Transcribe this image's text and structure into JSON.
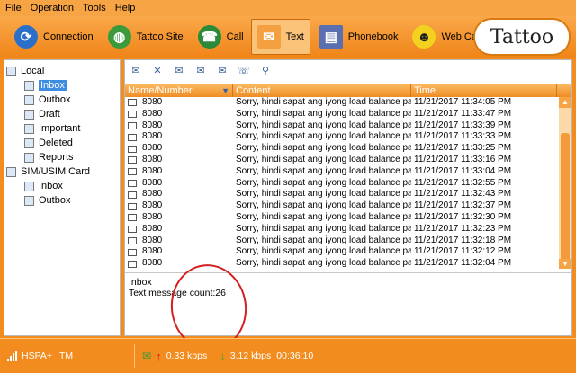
{
  "menu": [
    "File",
    "Operation",
    "Tools",
    "Help"
  ],
  "toolbar": {
    "connection": "Connection",
    "tattoo_site": "Tattoo Site",
    "call": "Call",
    "text": "Text",
    "phonebook": "Phonebook",
    "web_calls": "Web Calls",
    "logo": "Tattoo"
  },
  "tree": {
    "local": "Local",
    "inbox": "Inbox",
    "outbox": "Outbox",
    "draft": "Draft",
    "important": "Important",
    "deleted": "Deleted",
    "reports": "Reports",
    "sim": "SIM/USIM Card",
    "sim_inbox": "Inbox",
    "sim_outbox": "Outbox"
  },
  "columns": {
    "name": "Name/Number",
    "content": "Content",
    "time": "Time"
  },
  "messages": [
    {
      "num": "8080",
      "content": "Sorry, hindi sapat ang iyong load balance para ma...",
      "time": "11/21/2017 11:34:05 PM"
    },
    {
      "num": "8080",
      "content": "Sorry, hindi sapat ang iyong load balance para ma...",
      "time": "11/21/2017 11:33:47 PM"
    },
    {
      "num": "8080",
      "content": "Sorry, hindi sapat ang iyong load balance para ma...",
      "time": "11/21/2017 11:33:39 PM"
    },
    {
      "num": "8080",
      "content": "Sorry, hindi sapat ang iyong load balance para ma...",
      "time": "11/21/2017 11:33:33 PM"
    },
    {
      "num": "8080",
      "content": "Sorry, hindi sapat ang iyong load balance para ma...",
      "time": "11/21/2017 11:33:25 PM"
    },
    {
      "num": "8080",
      "content": "Sorry, hindi sapat ang iyong load balance para ma...",
      "time": "11/21/2017 11:33:16 PM"
    },
    {
      "num": "8080",
      "content": "Sorry, hindi sapat ang iyong load balance para ma...",
      "time": "11/21/2017 11:33:04 PM"
    },
    {
      "num": "8080",
      "content": "Sorry, hindi sapat ang iyong load balance para ma...",
      "time": "11/21/2017 11:32:55 PM"
    },
    {
      "num": "8080",
      "content": "Sorry, hindi sapat ang iyong load balance para ma...",
      "time": "11/21/2017 11:32:43 PM"
    },
    {
      "num": "8080",
      "content": "Sorry, hindi sapat ang iyong load balance para ma...",
      "time": "11/21/2017 11:32:37 PM"
    },
    {
      "num": "8080",
      "content": "Sorry, hindi sapat ang iyong load balance para ma...",
      "time": "11/21/2017 11:32:30 PM"
    },
    {
      "num": "8080",
      "content": "Sorry, hindi sapat ang iyong load balance para ma...",
      "time": "11/21/2017 11:32:23 PM"
    },
    {
      "num": "8080",
      "content": "Sorry, hindi sapat ang iyong load balance para ma...",
      "time": "11/21/2017 11:32:18 PM"
    },
    {
      "num": "8080",
      "content": "Sorry, hindi sapat ang iyong load balance para ma...",
      "time": "11/21/2017 11:32:12 PM"
    },
    {
      "num": "8080",
      "content": "Sorry, hindi sapat ang iyong load balance para ma...",
      "time": "11/21/2017 11:32:04 PM"
    }
  ],
  "preview": {
    "folder": "Inbox",
    "count": "Text message count:26"
  },
  "status": {
    "network": "HSPA+",
    "carrier": "TM",
    "upload": "0.33 kbps",
    "download": "3.12 kbps",
    "duration": "00:36:10"
  }
}
